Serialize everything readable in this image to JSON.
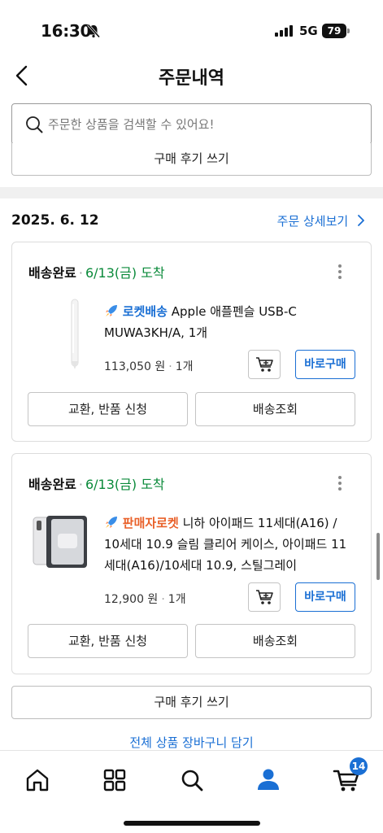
{
  "status_bar": {
    "time": "16:30",
    "network": "5G",
    "battery": "79"
  },
  "header": {
    "title": "주문내역"
  },
  "search": {
    "placeholder": "주문한 상품을 검색할 수 있어요!"
  },
  "review_button_top": "구매 후기 쓰기",
  "order": {
    "date": "2025. 6. 12",
    "detail_link": "주문 상세보기",
    "items": [
      {
        "status": "배송완료",
        "arrival": "6/13(금) 도착",
        "badge": "로켓배송",
        "badge_icon": "rocket-icon",
        "name": "Apple 애플펜슬 USB-C MUWA3KH/A, 1개",
        "price": "113,050 원",
        "qty": "1개",
        "buy_label": "바로구매",
        "exchange_label": "교환, 반품 신청",
        "tracking_label": "배송조회"
      },
      {
        "status": "배송완료",
        "arrival": "6/13(금) 도착",
        "badge": "판매자로켓",
        "badge_icon": "rocket-icon",
        "name": "니하 아이패드 11세대(A16) / 10세대 10.9 슬림 클리어 케이스, 아이패드 11세대(A16)/10세대 10.9, 스틸그레이",
        "price": "12,900 원",
        "qty": "1개",
        "buy_label": "바로구매",
        "exchange_label": "교환, 반품 신청",
        "tracking_label": "배송조회"
      }
    ]
  },
  "review_button_bottom": "구매 후기 쓰기",
  "cart_all_link": "전체 상품 장바구니 담기",
  "tabbar": {
    "tabs": [
      {
        "name": "home",
        "icon": "home-icon"
      },
      {
        "name": "categories",
        "icon": "grid-icon"
      },
      {
        "name": "search",
        "icon": "search-icon"
      },
      {
        "name": "my",
        "icon": "person-icon",
        "active": true
      },
      {
        "name": "cart",
        "icon": "cart-icon"
      }
    ],
    "cart_count": "14"
  },
  "colors": {
    "accent": "#1a6fd4",
    "arrival_green": "#0a8a3a",
    "seller_orange": "#e9612a"
  }
}
